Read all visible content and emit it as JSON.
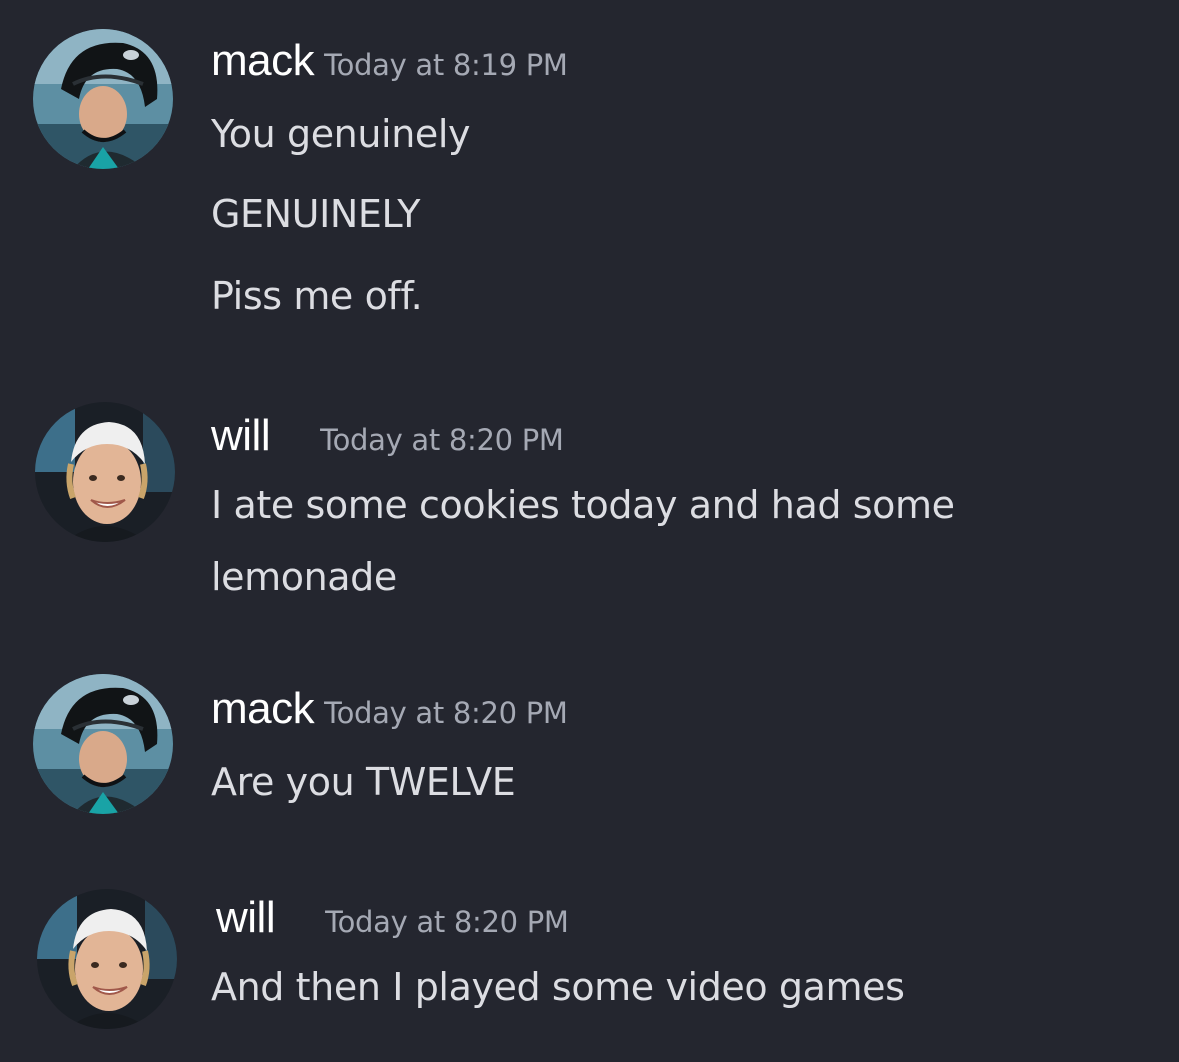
{
  "messages": [
    {
      "username": "mack",
      "timestamp": "Today at 8:19 PM",
      "avatar": "mack-avatar",
      "lines": [
        "You genuinely",
        "GENUINELY",
        "Piss me off."
      ]
    },
    {
      "username": "will",
      "timestamp": "Today at 8:20 PM",
      "avatar": "will-avatar",
      "lines": [
        "I ate some cookies today and had some",
        "lemonade"
      ]
    },
    {
      "username": "mack",
      "timestamp": "Today at 8:20 PM",
      "avatar": "mack-avatar",
      "lines": [
        "Are you TWELVE"
      ]
    },
    {
      "username": "will",
      "timestamp": "Today at 8:20 PM",
      "avatar": "will-avatar",
      "lines": [
        "And then I played some video games"
      ]
    }
  ],
  "colors": {
    "background": "#24262f",
    "username": "#ffffff",
    "timestamp": "#a5a9b4",
    "message_text": "#dcdde2"
  }
}
